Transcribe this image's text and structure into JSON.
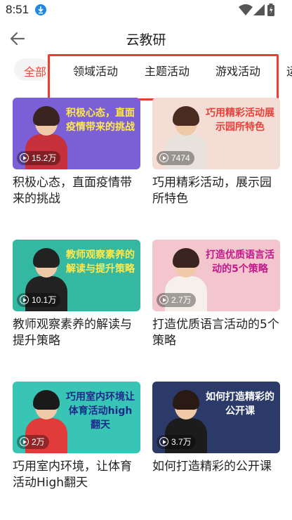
{
  "status": {
    "time": "8:51"
  },
  "header": {
    "title": "云教研"
  },
  "tabs": {
    "all_label": "全部",
    "items": [
      "领域活动",
      "主题活动",
      "游戏活动",
      "运"
    ]
  },
  "cards": [
    {
      "title": "积极心态，直面疫情带来的挑战",
      "views": "15.2万",
      "thumb_text": "积极心态，直面疫情带来的挑战",
      "bg": "#7a5fd6",
      "text_color": "#ffe94a"
    },
    {
      "title": "巧用精彩活动，展示园所特色",
      "views": "7474",
      "thumb_text": "巧用精彩活动展示园所特色",
      "bg": "#f3ddd4",
      "text_color": "#e8403a"
    },
    {
      "title": "教师观察素养的解读与提升策略",
      "views": "10.1万",
      "thumb_text": "教师观察素养的解读与提升策略",
      "bg": "#35b8a2",
      "text_color": "#ffe94a"
    },
    {
      "title": "打造优质语言活动的5个策略",
      "views": "2.7万",
      "thumb_text": "打造优质语言活动的5个策略",
      "bg": "#f2c6cc",
      "text_color": "#c2188b"
    },
    {
      "title": "巧用室内环境，让体育活动High翻天",
      "views": "2万",
      "thumb_text": "巧用室内环境让体育活动high翻天",
      "bg": "#38c5b6",
      "text_color": "#1e2a8a"
    },
    {
      "title": "如何打造精彩的公开课",
      "views": "3.7万",
      "thumb_text": "如何打造精彩的公开课",
      "bg": "#2c3a6a",
      "text_color": "#ffffff"
    }
  ]
}
